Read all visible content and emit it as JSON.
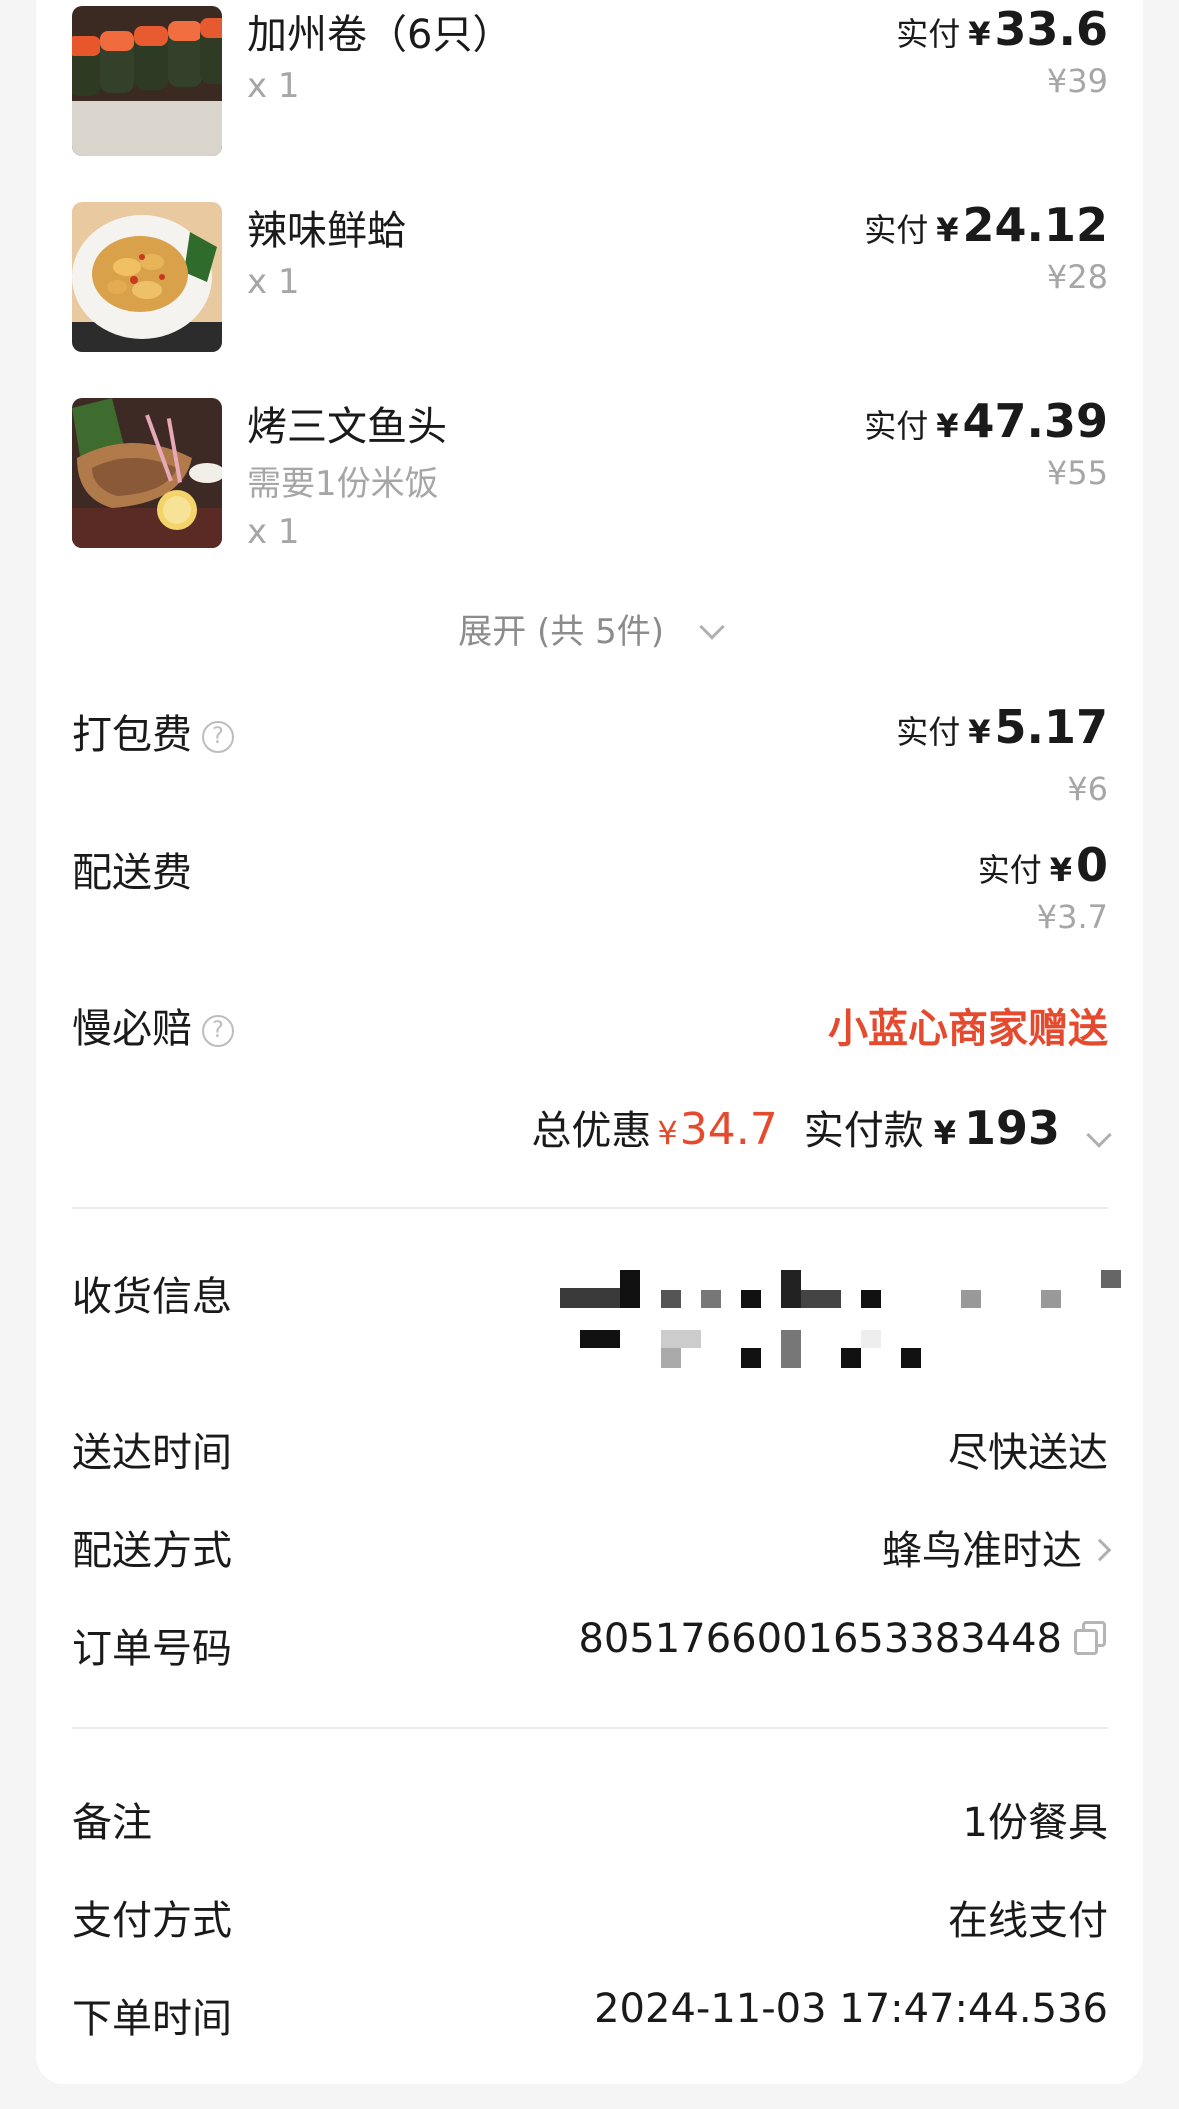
{
  "items": [
    {
      "name": "加州卷（6只）",
      "qty": "x 1",
      "note": "",
      "pay_label": "实付",
      "yen": "¥",
      "paid": "33.6",
      "original": "¥39"
    },
    {
      "name": "辣味鲜蛤",
      "qty": "x 1",
      "note": "",
      "pay_label": "实付",
      "yen": "¥",
      "paid": "24.12",
      "original": "¥28"
    },
    {
      "name": "烤三文鱼头",
      "qty": "x 1",
      "note": "需要1份米饭",
      "pay_label": "实付",
      "yen": "¥",
      "paid": "47.39",
      "original": "¥55"
    }
  ],
  "expand": {
    "label": "展开 (共 5件)"
  },
  "fees": {
    "packing": {
      "label": "打包费",
      "pay_label": "实付",
      "yen": "¥",
      "paid": "5.17",
      "original": "¥6"
    },
    "delivery": {
      "label": "配送费",
      "pay_label": "实付",
      "yen": "¥",
      "paid": "0",
      "original": "¥3.7"
    },
    "slow_compensation": {
      "label": "慢必赔",
      "value": "小蓝心商家赠送"
    }
  },
  "help_glyph": "?",
  "summary": {
    "discount_label": "总优惠",
    "discount_yen": "¥",
    "discount_value": "34.7",
    "paid_label": "实付款",
    "paid_yen": "¥",
    "paid_value": "193"
  },
  "info": {
    "receiver": {
      "label": "收货信息"
    },
    "arrival": {
      "label": "送达时间",
      "value": "尽快送达"
    },
    "method": {
      "label": "配送方式",
      "value": "蜂鸟准时达"
    },
    "order_no": {
      "label": "订单号码",
      "value": "8051766001653383448"
    }
  },
  "extra": {
    "remark": {
      "label": "备注",
      "value": "1份餐具"
    },
    "payment": {
      "label": "支付方式",
      "value": "在线支付"
    },
    "order_time": {
      "label": "下单时间",
      "value": "2024-11-03 17:47:44.536"
    }
  },
  "colors": {
    "accent_red": "#e64a2e",
    "text": "#1a1a1a",
    "muted": "#a6a6a6",
    "divider": "#ececec"
  },
  "icons": [
    "help-icon",
    "chevron-down-icon",
    "chevron-right-icon",
    "copy-icon"
  ]
}
